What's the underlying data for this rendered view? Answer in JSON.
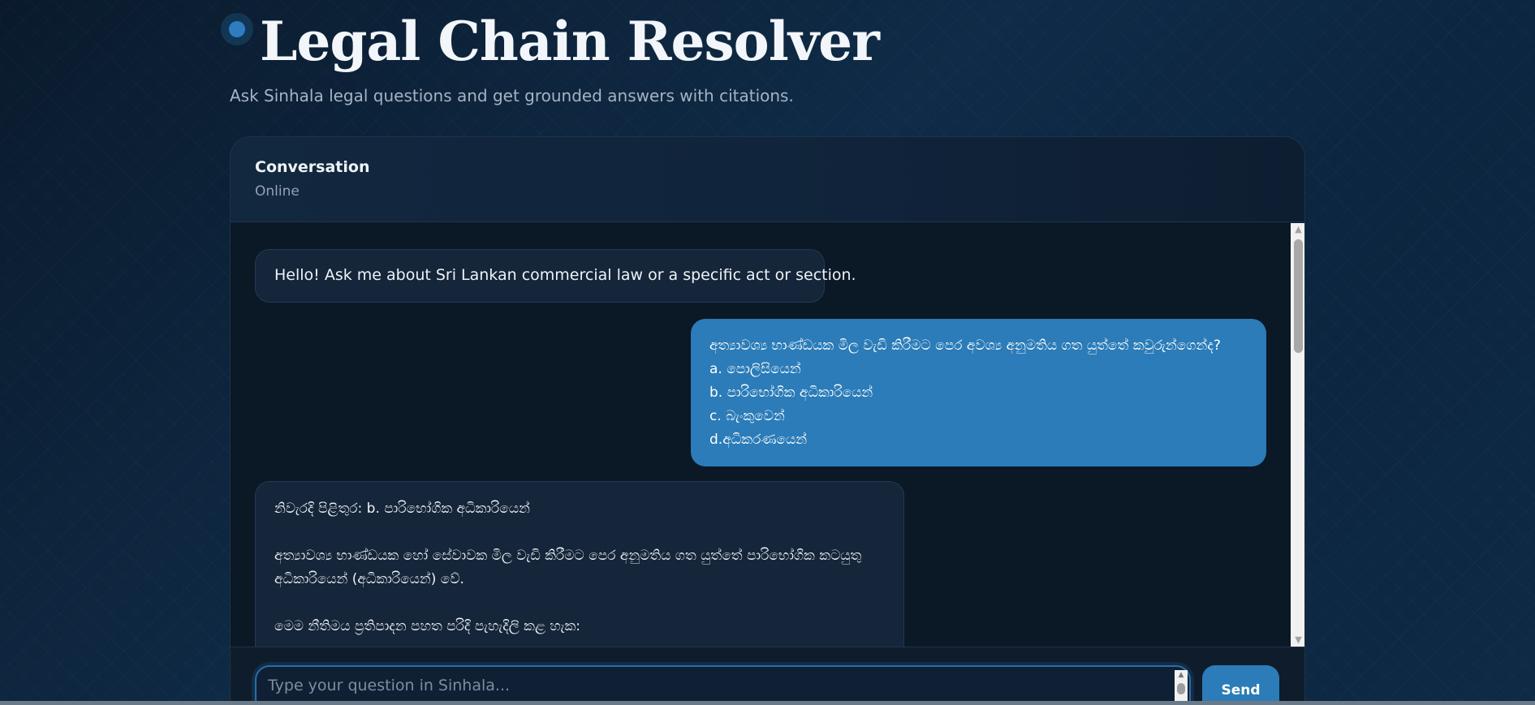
{
  "header": {
    "title": "Legal Chain Resolver",
    "subtitle": "Ask Sinhala legal questions and get grounded answers with citations."
  },
  "conversation": {
    "title": "Conversation",
    "status": "Online"
  },
  "messages": {
    "greeting": "Hello! Ask me about Sri Lankan commercial law or a specific act or section.",
    "user_question": {
      "question": "අත්‍යාවශ්‍ය භාණ්ඩයක මිල වැඩි කිරීමට පෙර අවශ්‍ය අනුමතිය ගත යුත්තේ කවුරුන්ගෙන්ද?",
      "option_a": "a. පොලිසියෙන්",
      "option_b": "b. පාරිභෝගික අධිකාරියෙන්",
      "option_c": "c. බැංකුවෙන්",
      "option_d": "d.අධිකරණයෙන්"
    },
    "answer": {
      "line1": "නිවැරදි පිළිතුර: b. පාරිභෝගික අධිකාරියෙන්",
      "line2": "අත්‍යාවශ්‍ය භාණ්ඩයක හෝ සේවාවක මිල වැඩි කිරීමට පෙර අනුමතිය ගත යුත්තේ පාරිභෝගික කටයුතු",
      "line3": "අධිකාරියෙන් (අධිකාරියෙන්) වේ.",
      "line4": "මෙම නීතිමය ප්‍රතිපාදන පහත පරිදි පැහැදිලි කළ හැක:"
    }
  },
  "composer": {
    "placeholder": "Type your question in Sinhala...",
    "send_label": "Send"
  },
  "colors": {
    "accent": "#2b7cb8",
    "panel_bg": "#0d1b2b",
    "bot_bubble": "#15263a"
  }
}
